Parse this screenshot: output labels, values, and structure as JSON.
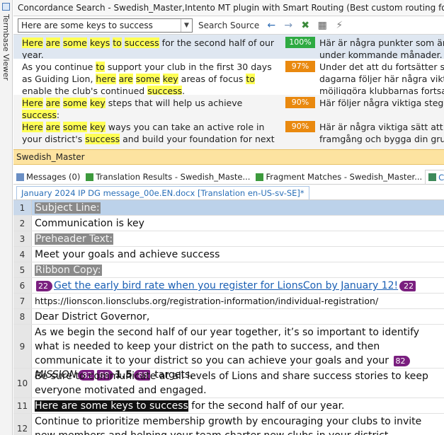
{
  "termbase_viewer": {
    "label": "Termbase Viewer"
  },
  "concordance": {
    "title": "Concordance Search - Swedish_Master,Intento MT plugin with Smart Routing (Best custom routing for Lions Club)",
    "search_value": "Here are some keys to success",
    "search_source_label": "Search Source",
    "results": [
      {
        "score": "100%",
        "score_color": "#2eaa42",
        "source_parts": [
          {
            "t": "Here",
            "h": true
          },
          {
            "t": " ",
            "h": false
          },
          {
            "t": "are",
            "h": true
          },
          {
            "t": " ",
            "h": false
          },
          {
            "t": "some",
            "h": true
          },
          {
            "t": " ",
            "h": false
          },
          {
            "t": "keys",
            "h": true
          },
          {
            "t": " ",
            "h": false
          },
          {
            "t": "to",
            "h": true
          },
          {
            "t": " ",
            "h": false
          },
          {
            "t": "success",
            "h": true
          },
          {
            "t": " for the second half of our year.",
            "h": false
          }
        ],
        "target_lines": [
          "Här är några punkter som är a",
          "under kommande månader."
        ]
      },
      {
        "score": "97%",
        "score_color": "#e9890f",
        "source_parts": [
          {
            "t": "As you continue ",
            "h": false
          },
          {
            "t": "to",
            "h": true
          },
          {
            "t": " support your club in the first 30 days as Guiding Lion, ",
            "h": false
          },
          {
            "t": "here",
            "h": true
          },
          {
            "t": " ",
            "h": false
          },
          {
            "t": "are",
            "h": true
          },
          {
            "t": " ",
            "h": false
          },
          {
            "t": "some",
            "h": true
          },
          {
            "t": " ",
            "h": false
          },
          {
            "t": "key",
            "h": true
          },
          {
            "t": " areas of focus ",
            "h": false
          },
          {
            "t": "to",
            "h": true
          },
          {
            "t": " enable the club's continued ",
            "h": false
          },
          {
            "t": "success",
            "h": true
          },
          {
            "t": ".",
            "h": false
          }
        ],
        "target_lines": [
          "Under det att du fortsätter stö",
          "dagarna följer här några viktig",
          "möjliggöra klubbarnas fortsat"
        ]
      },
      {
        "score": "90%",
        "score_color": "#e9890f",
        "source_parts": [
          {
            "t": "Here",
            "h": true
          },
          {
            "t": " ",
            "h": false
          },
          {
            "t": "are",
            "h": true
          },
          {
            "t": " ",
            "h": false
          },
          {
            "t": "some",
            "h": true
          },
          {
            "t": " ",
            "h": false
          },
          {
            "t": "key",
            "h": true
          },
          {
            "t": " steps that will help us achieve ",
            "h": false
          },
          {
            "t": "success",
            "h": true
          },
          {
            "t": ":",
            "h": false
          }
        ],
        "target_lines": [
          "Här följer några viktiga steg so"
        ]
      },
      {
        "score": "90%",
        "score_color": "#e9890f",
        "source_parts": [
          {
            "t": "Here",
            "h": true
          },
          {
            "t": " ",
            "h": false
          },
          {
            "t": "are",
            "h": true
          },
          {
            "t": " ",
            "h": false
          },
          {
            "t": "some",
            "h": true
          },
          {
            "t": " ",
            "h": false
          },
          {
            "t": "key",
            "h": true
          },
          {
            "t": " ways you can take an active role in your district's ",
            "h": false
          },
          {
            "t": "success",
            "h": true
          },
          {
            "t": " and build your foundation for next year.",
            "h": false
          }
        ],
        "target_lines": [
          "Här är några viktiga sätt att ta",
          "framgång och bygga din grun"
        ]
      }
    ],
    "tm_name": "Swedish_Master"
  },
  "tabs": [
    {
      "label": "Messages (0)",
      "icon": "messages-icon",
      "active": false
    },
    {
      "label": "Translation Results - Swedish_Maste...",
      "icon": "translation-results-icon",
      "active": false
    },
    {
      "label": "Fragment Matches - Swedish_Master...",
      "icon": "fragment-matches-icon",
      "active": false
    },
    {
      "label": "Concordance Se",
      "icon": "concordance-icon",
      "active": true
    }
  ],
  "document_tab": "January 2024 IP DG message_00e.EN.docx [Translation en-US-sv-SE]*",
  "segments": {
    "s1": "Subject Line:",
    "s2": "Communication is key",
    "s3": "Preheader Text:",
    "s4": "Meet your goals and achieve success",
    "s5": "Ribbon Copy:",
    "s6_tag": "22",
    "s6_link": "Get the early bird rate when you register for LionsCon by January 12!",
    "s7": "https://lionscon.lionsclubs.org/registration-information/individual-registration/",
    "s8": "Dear District Governor,",
    "s9_a": "As we begin the second half of our year together, it’s so important to identify what is needed to keep your district on the path to success, and then communicate it to your district so you can achieve your goals and your ",
    "s9_tag1": "82",
    "s9_mission": "MISSION",
    "s9_tag2": "88",
    "s9_num": "1.5",
    "s9_b": " targets.",
    "s10": "Be sure to communicate at all levels of Lions and share success stories to keep everyone motivated and engaged.",
    "s11_hl": "Here are some keys to success",
    "s11_rest": " for the second half of our year.",
    "s12": "Continue to prioritize membership growth by encouraging your clubs to invite new members and helping your team charter new clubs in your district."
  },
  "segment_numbers": [
    "1",
    "2",
    "3",
    "4",
    "5",
    "6",
    "7",
    "8",
    "9",
    "10",
    "11",
    "12"
  ]
}
